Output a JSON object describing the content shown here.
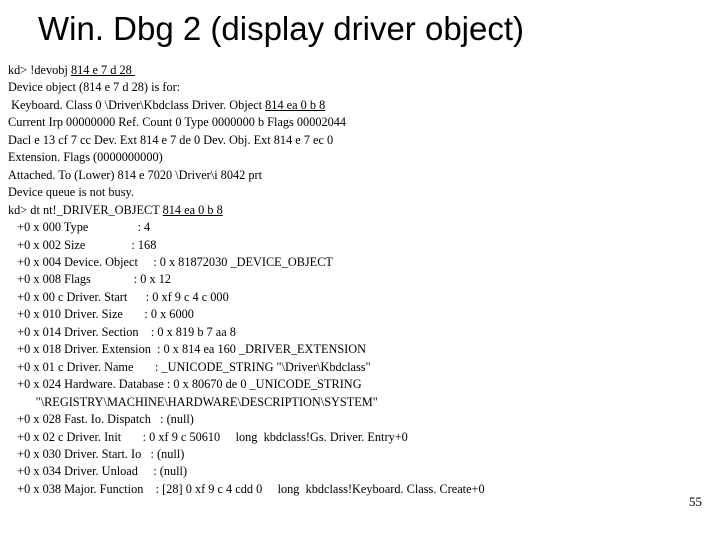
{
  "title": "Win. Dbg 2 (display driver object)",
  "pageno": "55",
  "lines": {
    "l00a": "kd> !devobj ",
    "l00b": "814 e 7 d 28 ",
    "l01": "Device object (814 e 7 d 28) is for:",
    "l02a": " Keyboard. Class 0 \\Driver\\Kbdclass Driver. Object ",
    "l02b": "814 ea 0 b 8",
    "l03": "Current Irp 00000000 Ref. Count 0 Type 0000000 b Flags 00002044",
    "l04": "Dacl e 13 cf 7 cc Dev. Ext 814 e 7 de 0 Dev. Obj. Ext 814 e 7 ec 0",
    "l05": "Extension. Flags (0000000000)",
    "l06": "Attached. To (Lower) 814 e 7020 \\Driver\\i 8042 prt",
    "l07": "Device queue is not busy.",
    "l08a": "kd> dt nt!_DRIVER_OBJECT ",
    "l08b": "814 ea 0 b 8",
    "l09": "   +0 x 000 Type                : 4",
    "l10": "   +0 x 002 Size               : 168",
    "l11": "   +0 x 004 Device. Object     : 0 x 81872030 _DEVICE_OBJECT",
    "l12": "   +0 x 008 Flags              : 0 x 12",
    "l13": "   +0 x 00 c Driver. Start      : 0 xf 9 c 4 c 000",
    "l14": "   +0 x 010 Driver. Size       : 0 x 6000",
    "l15": "   +0 x 014 Driver. Section    : 0 x 819 b 7 aa 8",
    "l16": "   +0 x 018 Driver. Extension  : 0 x 814 ea 160 _DRIVER_EXTENSION",
    "l17": "   +0 x 01 c Driver. Name       : _UNICODE_STRING \"\\Driver\\Kbdclass\"",
    "l18": "   +0 x 024 Hardware. Database : 0 x 80670 de 0 _UNICODE_STRING",
    "l19": "         \"\\REGISTRY\\MACHINE\\HARDWARE\\DESCRIPTION\\SYSTEM\"",
    "l20": "   +0 x 028 Fast. Io. Dispatch   : (null)",
    "l21": "   +0 x 02 c Driver. Init       : 0 xf 9 c 50610     long  kbdclass!Gs. Driver. Entry+0",
    "l22": "   +0 x 030 Driver. Start. Io   : (null)",
    "l23": "   +0 x 034 Driver. Unload     : (null)",
    "l24": "   +0 x 038 Major. Function    : [28] 0 xf 9 c 4 cdd 0     long  kbdclass!Keyboard. Class. Create+0"
  }
}
